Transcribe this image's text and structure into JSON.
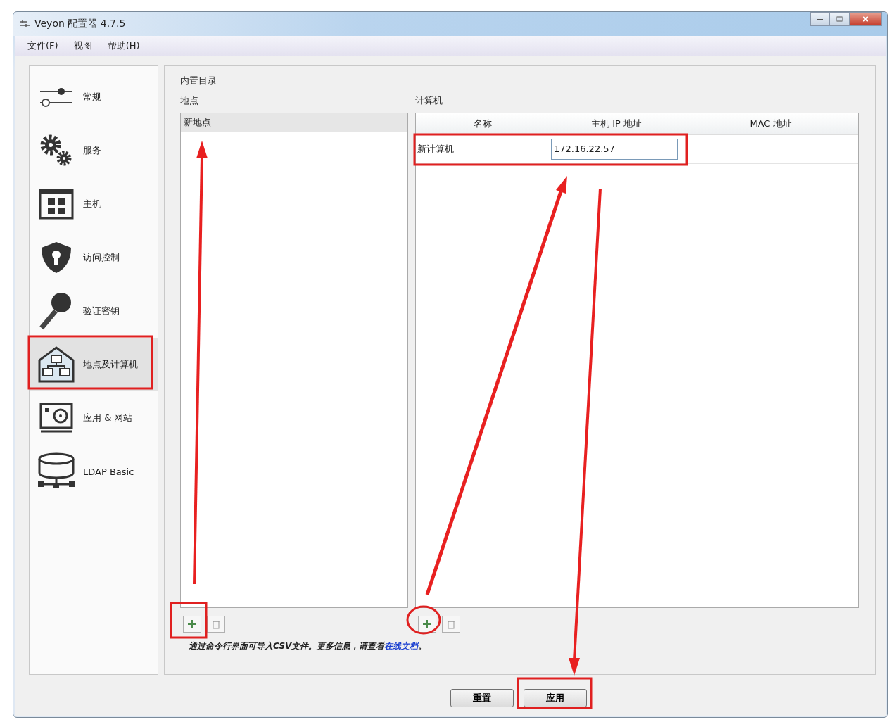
{
  "window": {
    "title": "Veyon 配置器 4.7.5"
  },
  "menu": [
    "文件(F)",
    "视图",
    "帮助(H)"
  ],
  "sidebar": {
    "items": [
      {
        "label": "常规",
        "selected": false
      },
      {
        "label": "服务",
        "selected": false
      },
      {
        "label": "主机",
        "selected": false
      },
      {
        "label": "访问控制",
        "selected": false
      },
      {
        "label": "验证密钥",
        "selected": false
      },
      {
        "label": "地点及计算机",
        "selected": true
      },
      {
        "label": "应用 & 网站",
        "selected": false
      },
      {
        "label": "LDAP Basic",
        "selected": false
      }
    ]
  },
  "section_title": "内置目录",
  "locations": {
    "heading": "地点",
    "items": [
      {
        "label": "新地点",
        "selected": true
      }
    ]
  },
  "computers": {
    "heading": "计算机",
    "columns": [
      "名称",
      "主机 IP 地址",
      "MAC 地址"
    ],
    "rows": [
      {
        "cells": [
          "新计算机",
          "172.16.22.57",
          ""
        ],
        "editing": true
      }
    ]
  },
  "note": {
    "text": "通过命令行界面可导入CSV文件。更多信息，请查看",
    "link": "在线文档",
    "end": "。"
  },
  "buttons": [
    "重置",
    "应用"
  ]
}
